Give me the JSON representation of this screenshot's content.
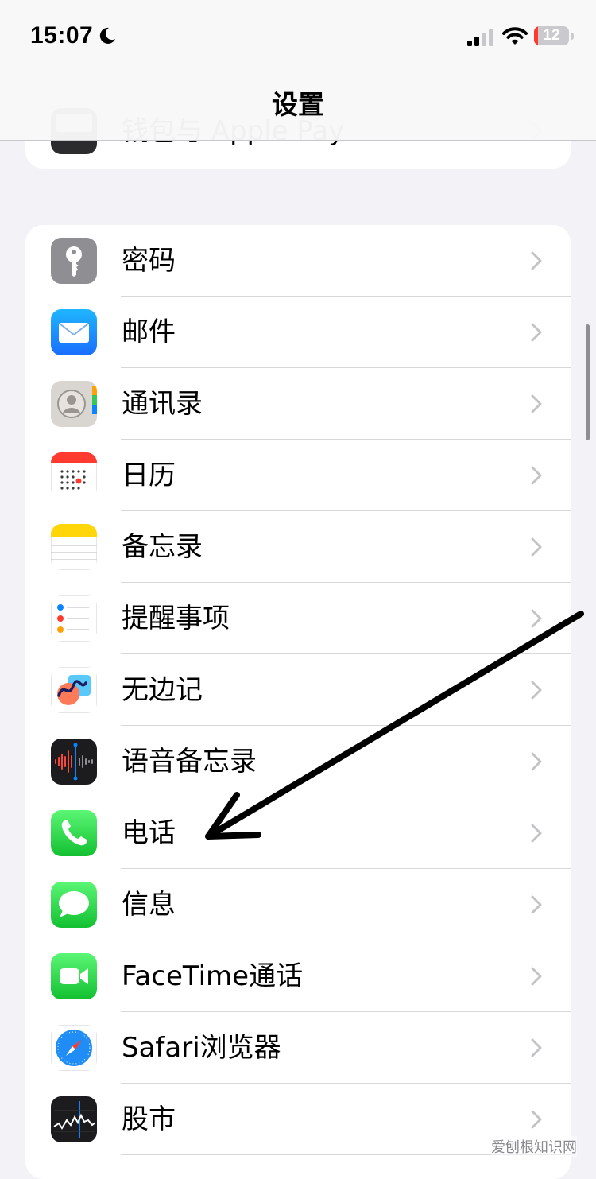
{
  "status_bar": {
    "time": "15:07",
    "battery_percent": "12",
    "battery_level": 0.12,
    "signal_bars_active": 2
  },
  "nav": {
    "title": "设置"
  },
  "top_group": {
    "partial_item_label": "钱包与 Apple Pay"
  },
  "settings": [
    {
      "label": "密码",
      "icon": "key-icon",
      "color": "#8e8e93"
    },
    {
      "label": "邮件",
      "icon": "mail-icon",
      "color": "#1a8cff"
    },
    {
      "label": "通讯录",
      "icon": "contacts-icon",
      "color": "#d9d5d0"
    },
    {
      "label": "日历",
      "icon": "calendar-icon",
      "color": "#ffffff"
    },
    {
      "label": "备忘录",
      "icon": "notes-icon",
      "color": "#ffd60a"
    },
    {
      "label": "提醒事项",
      "icon": "reminders-icon",
      "color": "#ffffff"
    },
    {
      "label": "无边记",
      "icon": "freeform-icon",
      "color": "#ffffff"
    },
    {
      "label": "语音备忘录",
      "icon": "voice-memos-icon",
      "color": "#1c1c1e"
    },
    {
      "label": "电话",
      "icon": "phone-icon",
      "color": "#34c759"
    },
    {
      "label": "信息",
      "icon": "messages-icon",
      "color": "#34c759"
    },
    {
      "label": "FaceTime通话",
      "icon": "facetime-icon",
      "color": "#34c759"
    },
    {
      "label": "Safari浏览器",
      "icon": "safari-icon",
      "color": "#1f8df5"
    },
    {
      "label": "股市",
      "icon": "stocks-icon",
      "color": "#1c1c1e"
    }
  ],
  "watermark": "爱刨根知识网"
}
